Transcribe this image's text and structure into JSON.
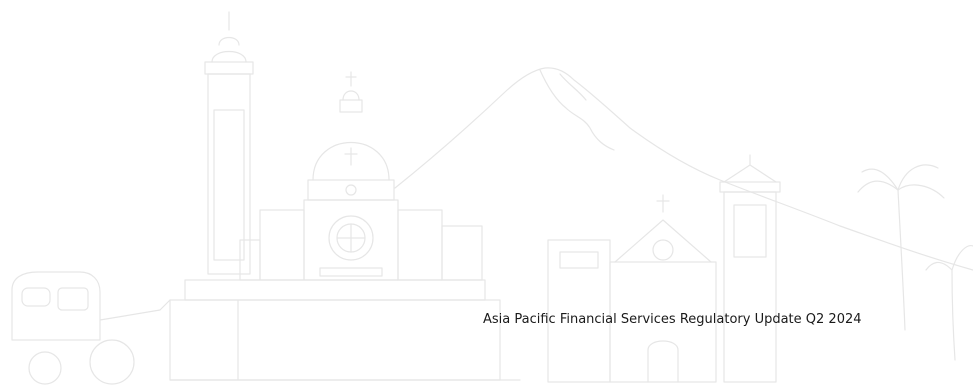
{
  "document": {
    "title": "Asia Pacific Financial Services Regulatory Update Q2 2024"
  },
  "illustration": {
    "name": "city-skyline-landmarks-line-art",
    "line_color": "#e6e6e6"
  }
}
